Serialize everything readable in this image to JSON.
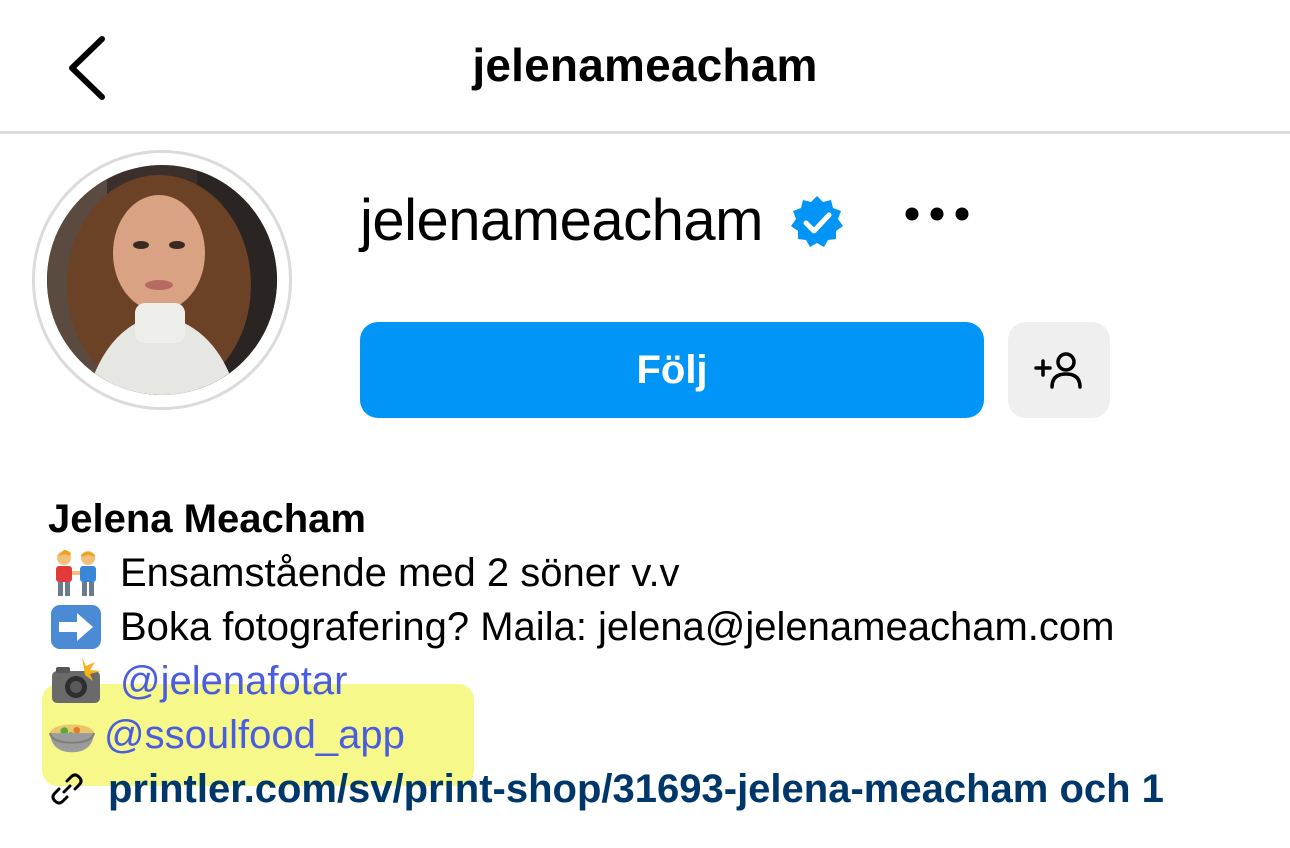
{
  "header": {
    "title": "jelenameacham",
    "back_icon": "chevron-left-icon"
  },
  "profile": {
    "username": "jelenameacham",
    "verified": true,
    "more_icon": "more-horizontal-icon",
    "follow_label": "Följ",
    "add_user_icon": "add-user-icon",
    "accent_color": "#0095f6"
  },
  "bio": {
    "name": "Jelena Meacham",
    "lines": [
      {
        "emoji": "👬",
        "text": "Ensamstående med 2 söner v.v"
      },
      {
        "emoji": "➡️",
        "text": "Boka fotografering? Maila: jelena@jelenameacham.com"
      },
      {
        "emoji": "📸",
        "text": "@jelenafotar"
      },
      {
        "emoji": "🍲",
        "text": "@ssoulfood_app"
      }
    ],
    "link": {
      "icon": "link-icon",
      "text": "printler.com/sv/print-shop/31693-jelena-meacham och 1"
    },
    "highlight_color": "#f7f88a"
  }
}
